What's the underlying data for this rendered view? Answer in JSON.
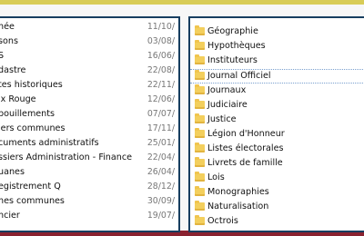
{
  "left_list": {
    "items": [
      {
        "name": "née",
        "date": "11/10/"
      },
      {
        "name": "sons",
        "date": "03/08/"
      },
      {
        "name": "S",
        "date": "16/06/"
      },
      {
        "name": "dastre",
        "date": "22/08/"
      },
      {
        "name": "tes historiques",
        "date": "22/11/"
      },
      {
        "name": "ix Rouge",
        "date": "12/06/"
      },
      {
        "name": "pouillements",
        "date": "07/07/"
      },
      {
        "name": "iers communes",
        "date": "17/11/"
      },
      {
        "name": "cuments administratifs",
        "date": "25/01/"
      },
      {
        "name": "ssiers Administration - Finance",
        "date": "22/04/"
      },
      {
        "name": "uanes",
        "date": "26/04/"
      },
      {
        "name": "egistrement Q",
        "date": "28/12/"
      },
      {
        "name": "nes communes",
        "date": "30/09/"
      },
      {
        "name": "ncier",
        "date": "19/07/"
      }
    ]
  },
  "right_list": {
    "items": [
      {
        "label": "Géographie"
      },
      {
        "label": "Hypothèques"
      },
      {
        "label": "Instituteurs"
      },
      {
        "label": "Journal Officiel"
      },
      {
        "label": "Journaux"
      },
      {
        "label": "Judiciaire"
      },
      {
        "label": "Justice"
      },
      {
        "label": "Légion d'Honneur"
      },
      {
        "label": "Listes électorales"
      },
      {
        "label": "Livrets de famille"
      },
      {
        "label": "Lois"
      },
      {
        "label": "Monographies"
      },
      {
        "label": "Naturalisation"
      },
      {
        "label": "Octrois"
      }
    ],
    "selected_index": 3
  }
}
